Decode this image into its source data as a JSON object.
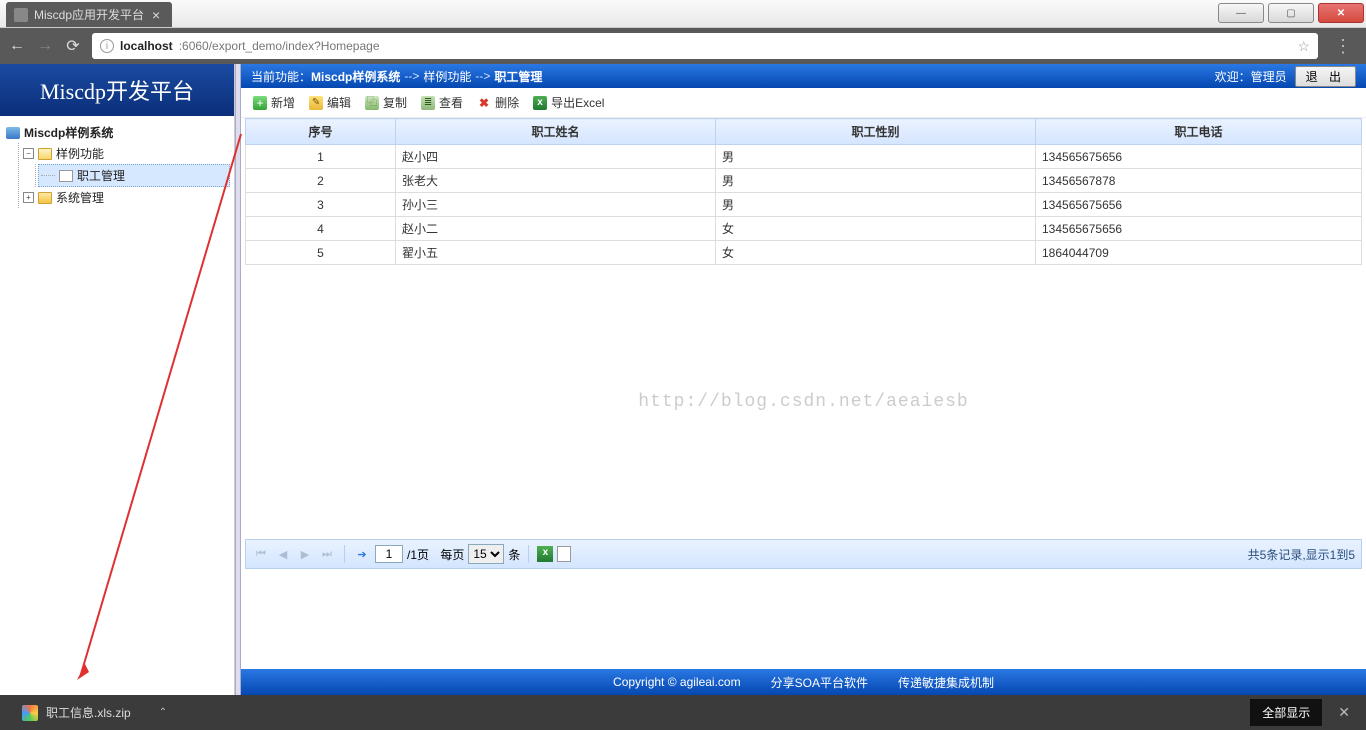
{
  "browser": {
    "tab_title": "Miscdp应用开发平台",
    "url_host": "localhost",
    "url_port_path": ":6060/export_demo/index?Homepage"
  },
  "sidebar": {
    "title": "Miscdp开发平台",
    "root": "Miscdp样例系统",
    "nodes": {
      "sample": "样例功能",
      "employee": "职工管理",
      "system": "系统管理"
    }
  },
  "breadcrumb": {
    "label": "当前功能：",
    "part1": "Miscdp样例系统",
    "part2": "样例功能",
    "part3": "职工管理",
    "arrow": "-->",
    "welcome": "欢迎：管理员",
    "logout": "退 出"
  },
  "toolbar": {
    "add": "新增",
    "edit": "编辑",
    "copy": "复制",
    "view": "查看",
    "del": "删除",
    "export": "导出Excel"
  },
  "table": {
    "headers": {
      "idx": "序号",
      "name": "职工姓名",
      "gender": "职工性别",
      "phone": "职工电话"
    },
    "rows": [
      {
        "idx": "1",
        "name": "赵小四",
        "gender": "男",
        "phone": "134565675656"
      },
      {
        "idx": "2",
        "name": "张老大",
        "gender": "男",
        "phone": "13456567878"
      },
      {
        "idx": "3",
        "name": "孙小三",
        "gender": "男",
        "phone": "134565675656"
      },
      {
        "idx": "4",
        "name": "赵小二",
        "gender": "女",
        "phone": "134565675656"
      },
      {
        "idx": "5",
        "name": "翟小五",
        "gender": "女",
        "phone": "1864044709"
      }
    ]
  },
  "watermark": "http://blog.csdn.net/aeaiesb",
  "pager": {
    "current": "1",
    "total_pages": "/1页",
    "per_page_label_pre": "每页",
    "per_page_value": "15",
    "per_page_label_post": "条",
    "summary": "共5条记录,显示1到5"
  },
  "footer": {
    "copyright": "Copyright © agileai.com",
    "slogan1": "分享SOA平台软件",
    "slogan2": "传递敏捷集成机制"
  },
  "download": {
    "filename": "职工信息.xls.zip",
    "show_all": "全部显示"
  }
}
